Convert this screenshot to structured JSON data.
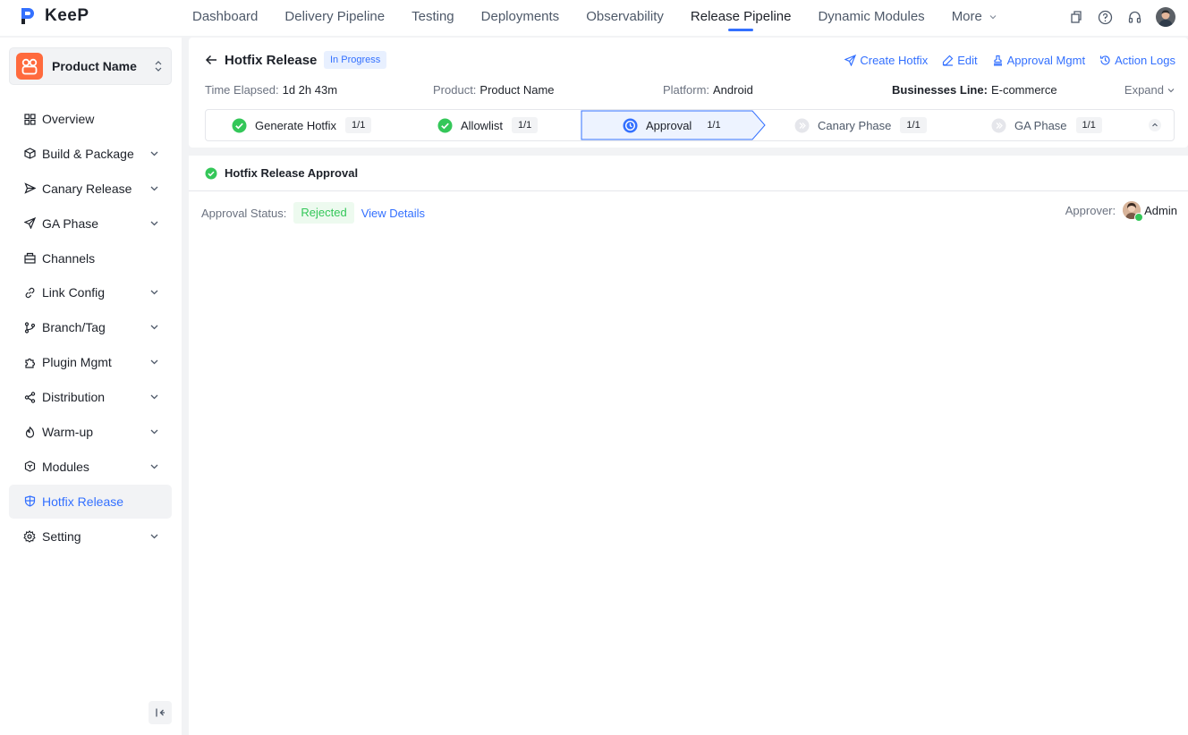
{
  "app": {
    "name": "KeeP"
  },
  "nav": {
    "tabs": [
      {
        "label": "Dashboard"
      },
      {
        "label": "Delivery Pipeline"
      },
      {
        "label": "Testing"
      },
      {
        "label": "Deployments"
      },
      {
        "label": "Observability"
      },
      {
        "label": "Release Pipeline",
        "active": true
      },
      {
        "label": "Dynamic Modules"
      },
      {
        "label": "More"
      }
    ],
    "icons": [
      "copy-icon",
      "help-icon",
      "headset-icon",
      "user-avatar"
    ]
  },
  "product": {
    "name": "Product Name"
  },
  "sidebar": {
    "items": [
      {
        "label": "Overview",
        "icon": "grid-icon"
      },
      {
        "label": "Build & Package",
        "icon": "package-icon",
        "expandable": true
      },
      {
        "label": "Canary Release",
        "icon": "send-icon",
        "expandable": true
      },
      {
        "label": "GA Phase",
        "icon": "rocket-icon",
        "expandable": true
      },
      {
        "label": "Channels",
        "icon": "channel-icon"
      },
      {
        "label": "Link Config",
        "icon": "link-icon",
        "expandable": true
      },
      {
        "label": "Branch/Tag",
        "icon": "branch-icon",
        "expandable": true
      },
      {
        "label": "Plugin Mgmt",
        "icon": "puzzle-icon",
        "expandable": true
      },
      {
        "label": "Distribution",
        "icon": "share-icon",
        "expandable": true
      },
      {
        "label": "Warm-up",
        "icon": "flame-icon",
        "expandable": true
      },
      {
        "label": "Modules",
        "icon": "cube-icon",
        "expandable": true
      },
      {
        "label": "Hotfix Release",
        "icon": "shield-icon",
        "active": true
      },
      {
        "label": "Setting",
        "icon": "gear-icon",
        "expandable": true
      }
    ]
  },
  "page": {
    "title": "Hotfix Release",
    "status": "In Progress",
    "actions": {
      "create": "Create Hotfix",
      "edit": "Edit",
      "approval": "Approval Mgmt",
      "logs": "Action Logs"
    },
    "meta": {
      "time_label": "Time Elapsed:",
      "time_value": "1d 2h 43m",
      "product_label": "Product:",
      "product_value": "Product Name",
      "platform_label": "Platform:",
      "platform_value": "Android",
      "business_label": "Businesses Line:",
      "business_value": "E-commerce"
    },
    "expand": "Expand"
  },
  "steps": [
    {
      "label": "Generate Hotfix",
      "count": "1/1",
      "state": "done"
    },
    {
      "label": "Allowlist",
      "count": "1/1",
      "state": "done"
    },
    {
      "label": "Approval",
      "count": "1/1",
      "state": "current"
    },
    {
      "label": "Canary Phase",
      "count": "1/1",
      "state": "pending"
    },
    {
      "label": "GA Phase",
      "count": "1/1",
      "state": "pending"
    }
  ],
  "section": {
    "title": "Hotfix Release Approval",
    "status_label": "Approval Status:",
    "status_value": "Rejected",
    "view_details": "View Details",
    "approver_label": "Approver:",
    "approver_name": "Admin"
  },
  "colors": {
    "accent": "#3370ff",
    "success": "#34c759",
    "brand": "#ff6a3d"
  }
}
